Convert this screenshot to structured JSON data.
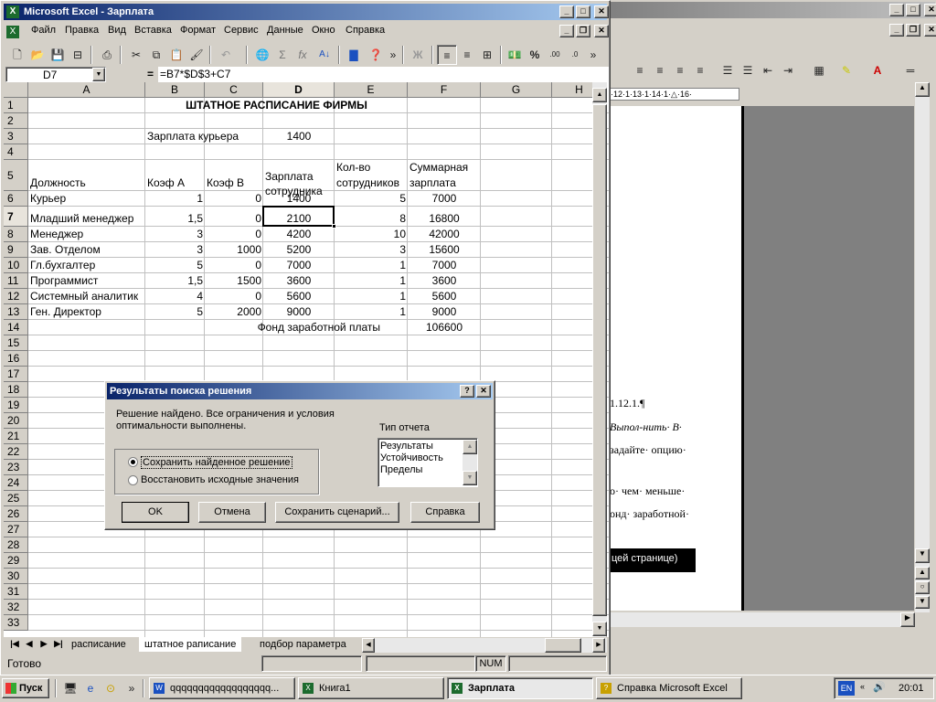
{
  "excel": {
    "title": "Microsoft Excel - Зарплата",
    "menu": [
      "Файл",
      "Правка",
      "Вид",
      "Вставка",
      "Формат",
      "Сервис",
      "Данные",
      "Окно",
      "Справка"
    ],
    "name_box": "D7",
    "formula_eq": "=",
    "formula": "=B7*$D$3+C7",
    "columns": [
      "A",
      "B",
      "C",
      "D",
      "E",
      "F",
      "G",
      "H"
    ],
    "rows": [
      "1",
      "2",
      "3",
      "4",
      "5",
      "6",
      "7",
      "8",
      "9",
      "10",
      "11",
      "12",
      "13",
      "14",
      "15",
      "16",
      "17",
      "18",
      "19",
      "20",
      "21",
      "22",
      "23",
      "24",
      "25",
      "26",
      "27",
      "28",
      "29",
      "30",
      "31",
      "32",
      "33"
    ],
    "cells": {
      "title": "ШТАТНОЕ РАСПИСАНИЕ ФИРМЫ",
      "courier_salary_label": "Зарплата курьера",
      "courier_salary_value": "1400",
      "h_position": "Должность",
      "h_coef_a": "Коэф А",
      "h_coef_b": "Коэф В",
      "h_salary_1": "Зарплата",
      "h_salary_2": "сотрудника",
      "h_count_1": "Кол-во",
      "h_count_2": "сотрудников",
      "h_total_1": "Суммарная",
      "h_total_2": "зарплата",
      "fund_label": "Фонд заработной платы",
      "fund_value": "106600"
    },
    "table": [
      {
        "a": "Курьер",
        "b": "1",
        "c": "0",
        "d": "1400",
        "e": "5",
        "f": "7000"
      },
      {
        "a": "Младший менеджер",
        "b": "1,5",
        "c": "0",
        "d": "2100",
        "e": "8",
        "f": "16800"
      },
      {
        "a": "Менеджер",
        "b": "3",
        "c": "0",
        "d": "4200",
        "e": "10",
        "f": "42000"
      },
      {
        "a": "Зав. Отделом",
        "b": "3",
        "c": "1000",
        "d": "5200",
        "e": "3",
        "f": "15600"
      },
      {
        "a": "Гл.бухгалтер",
        "b": "5",
        "c": "0",
        "d": "7000",
        "e": "1",
        "f": "7000"
      },
      {
        "a": "Программист",
        "b": "1,5",
        "c": "1500",
        "d": "3600",
        "e": "1",
        "f": "3600"
      },
      {
        "a": "Системный аналитик",
        "b": "4",
        "c": "0",
        "d": "5600",
        "e": "1",
        "f": "5600"
      },
      {
        "a": "Ген. Директор",
        "b": "5",
        "c": "2000",
        "d": "9000",
        "e": "1",
        "f": "9000"
      }
    ],
    "sheet_tabs": [
      "расписание",
      "штатное раписание",
      "подбор параметра"
    ],
    "status": "Готово",
    "status_num": "NUM"
  },
  "dialog": {
    "title": "Результаты поиска решения",
    "message_1": "Решение найдено. Все ограничения и условия",
    "message_2": "оптимальности выполнены.",
    "report_label": "Тип отчета",
    "reports": [
      "Результаты",
      "Устойчивость",
      "Пределы"
    ],
    "radio_keep": "Сохранить найденное решение",
    "radio_restore": "Восстановить исходные значения",
    "ok": "OK",
    "cancel": "Отмена",
    "save_scenario": "Сохранить сценарий...",
    "help": "Справка"
  },
  "word": {
    "ruler": "·12·1·13·1·14·1·△·16·",
    "lines": [
      "1.12.1.¶",
      "Выпол-нить· В·",
      "задайте· опцию·",
      "о· чем· меньше·",
      "онд· заработной·"
    ],
    "highlight": "цей странице)",
    "pilcrow": "¶"
  },
  "taskbar": {
    "start": "Пуск",
    "tasks": [
      "qqqqqqqqqqqqqqqqqq...",
      "Книга1",
      "Зарплата",
      "Справка Microsoft Excel"
    ],
    "lang": "EN",
    "clock": "20:01"
  },
  "colors": {
    "title_active": "#0a246a",
    "title_inactive": "#808080",
    "face": "#d4d0c8",
    "select": "#0a246a"
  }
}
